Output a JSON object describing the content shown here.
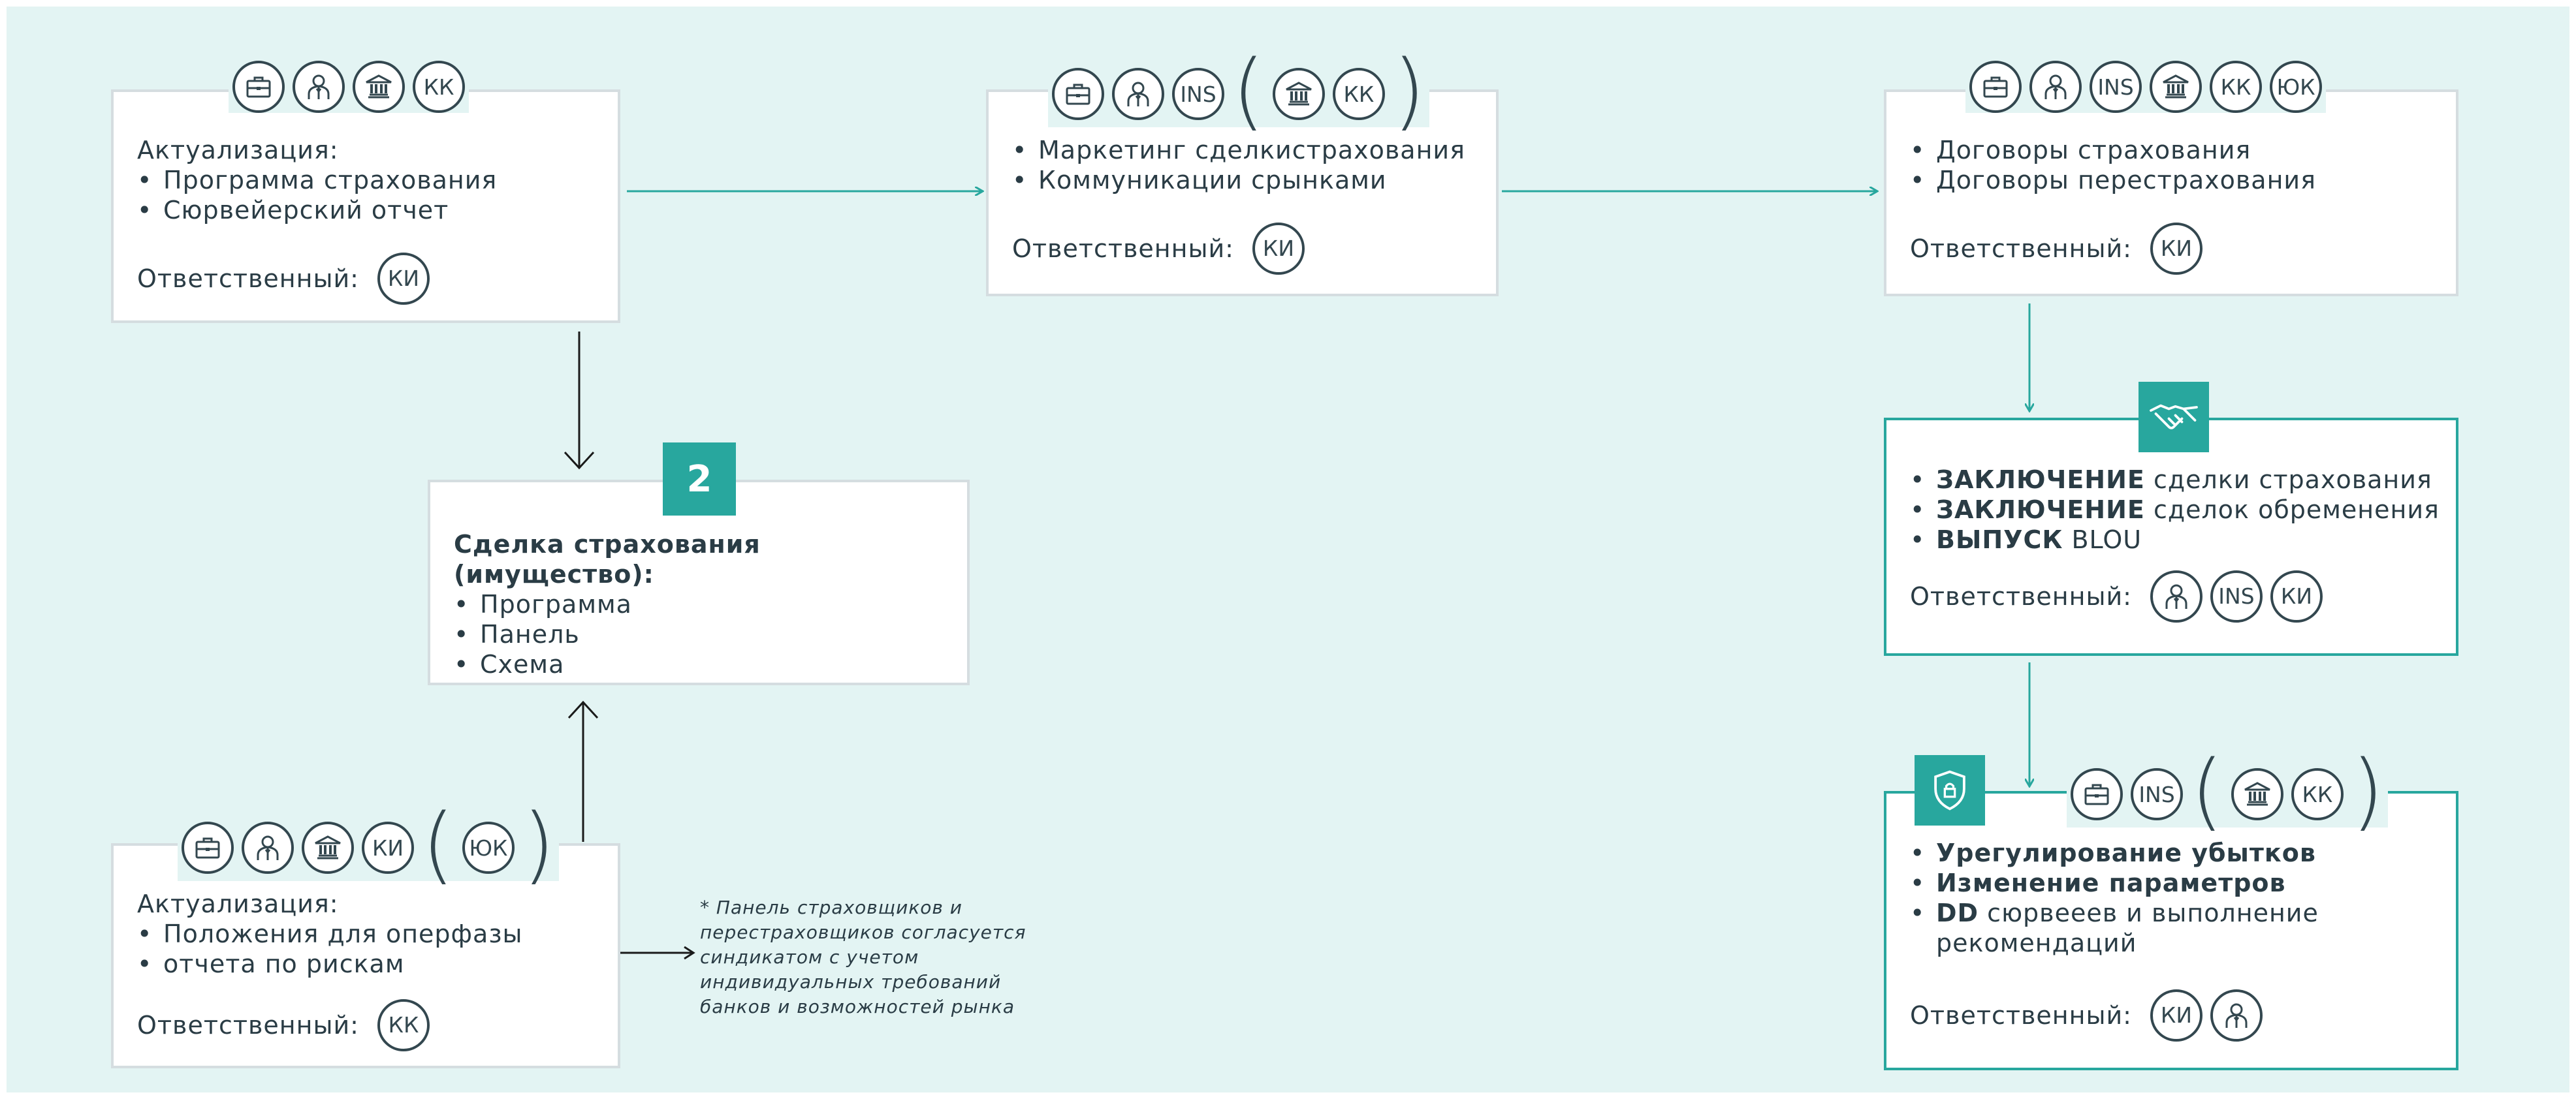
{
  "colors": {
    "teal": "#28a79e",
    "bg": "#e3f4f3",
    "dark": "#33474f",
    "border": "#d5dde0"
  },
  "box1": {
    "icons": [
      "briefcase-icon",
      "person-icon",
      "bank-icon",
      "КК"
    ],
    "title": "Актуализация:",
    "items": [
      "Программа страхования",
      "Сюрвейерский отчет"
    ],
    "resp_label": "Ответственный:",
    "resp_icons": [
      "КИ"
    ]
  },
  "box2": {
    "icons": [
      "briefcase-icon",
      "person-icon",
      "INS"
    ],
    "icons_paren": [
      "bank-icon",
      "КК"
    ],
    "items": [
      "Маркетинг сделкистрахования",
      "Коммуникации срынками"
    ],
    "resp_label": "Ответственный:",
    "resp_icons": [
      "КИ"
    ]
  },
  "box3": {
    "icons": [
      "briefcase-icon",
      "person-icon",
      "INS",
      "bank-icon",
      "КК",
      "ЮК"
    ],
    "items": [
      "Договоры страхования",
      "Договоры перестрахования"
    ],
    "resp_label": "Ответственный:",
    "resp_icons": [
      "КИ"
    ]
  },
  "center": {
    "badge": "2",
    "title": "Сделка страхования (имущество):",
    "items": [
      "Программа",
      "Панель",
      "Схема"
    ]
  },
  "box4": {
    "icon": "handshake-icon",
    "items": [
      {
        "bold": "ЗАКЛЮЧЕНИЕ",
        "rest": " сделки страхования"
      },
      {
        "bold": "ЗАКЛЮЧЕНИЕ",
        "rest": " сделок обременения"
      },
      {
        "bold": "ВЫПУСК",
        "rest": " BLOU"
      }
    ],
    "resp_label": "Ответственный:",
    "resp_icons": [
      "person-icon",
      "INS",
      "КИ"
    ]
  },
  "box5": {
    "icon": "shield-lock-icon",
    "icons": [
      "briefcase-icon",
      "INS"
    ],
    "icons_paren": [
      "bank-icon",
      "КК"
    ],
    "items": [
      {
        "bold": "Урегулирование убытков",
        "rest": ""
      },
      {
        "bold": "Изменение параметров",
        "rest": ""
      },
      {
        "bold": "DD",
        "rest": " сюрвееев и выполнение",
        "cont": "рекомендаций"
      }
    ],
    "resp_label": "Ответственный:",
    "resp_icons": [
      "КИ",
      "person-icon"
    ]
  },
  "box6": {
    "icons": [
      "briefcase-icon",
      "person-icon",
      "bank-icon",
      "КИ"
    ],
    "icons_paren": [
      "ЮК"
    ],
    "title": "Актуализация:",
    "items": [
      "Положения для оперфазы",
      "отчета по рискам"
    ],
    "resp_label": "Ответственный:",
    "resp_icons": [
      "КК"
    ]
  },
  "note": {
    "lines": [
      "* Панель страховщиков и",
      "перестраховщиков согласуется",
      "синдикатом с учетом",
      "индивидуальных требований",
      "банков и возможностей рынка"
    ]
  }
}
